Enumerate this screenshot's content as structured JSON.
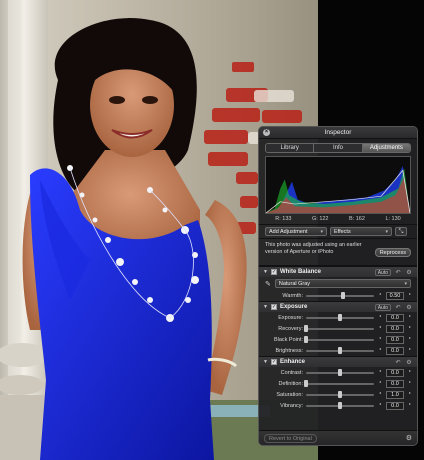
{
  "inspector": {
    "title": "Inspector",
    "tabs": [
      {
        "label": "Library",
        "active": false
      },
      {
        "label": "Info",
        "active": false
      },
      {
        "label": "Adjustments",
        "active": true
      }
    ],
    "histogram": {
      "readouts": [
        "R: 133",
        "G: 122",
        "B: 162",
        "L: 130"
      ],
      "colors": {
        "red": "#e03030",
        "green": "#30d040",
        "blue": "#3060ff",
        "luma": "#cccccc"
      }
    },
    "add_adjustment": "Add Adjustment",
    "effects": "Effects",
    "notice": "This photo was adjusted using an earlier version of Aperture or iPhoto",
    "reprocess": "Reprocess",
    "white_balance": {
      "title": "White Balance",
      "auto": "Auto",
      "preset": "Natural Gray",
      "params": [
        {
          "label": "Warmth:",
          "value": "0.50",
          "level": 0.55
        }
      ]
    },
    "exposure": {
      "title": "Exposure",
      "auto": "Auto",
      "params": [
        {
          "label": "Exposure:",
          "value": "0.0",
          "level": 0.5
        },
        {
          "label": "Recovery:",
          "value": "0.0",
          "level": 0.0
        },
        {
          "label": "Black Point:",
          "value": "0.0",
          "level": 0.0
        },
        {
          "label": "Brightness:",
          "value": "0.0",
          "level": 0.5
        }
      ]
    },
    "enhance": {
      "title": "Enhance",
      "params": [
        {
          "label": "Contrast:",
          "value": "0.0",
          "level": 0.5
        },
        {
          "label": "Definition:",
          "value": "0.0",
          "level": 0.0
        },
        {
          "label": "Saturation:",
          "value": "1.0",
          "level": 0.5
        },
        {
          "label": "Vibrancy:",
          "value": "0.0",
          "level": 0.5
        }
      ]
    },
    "revert": "Revert to Original"
  }
}
